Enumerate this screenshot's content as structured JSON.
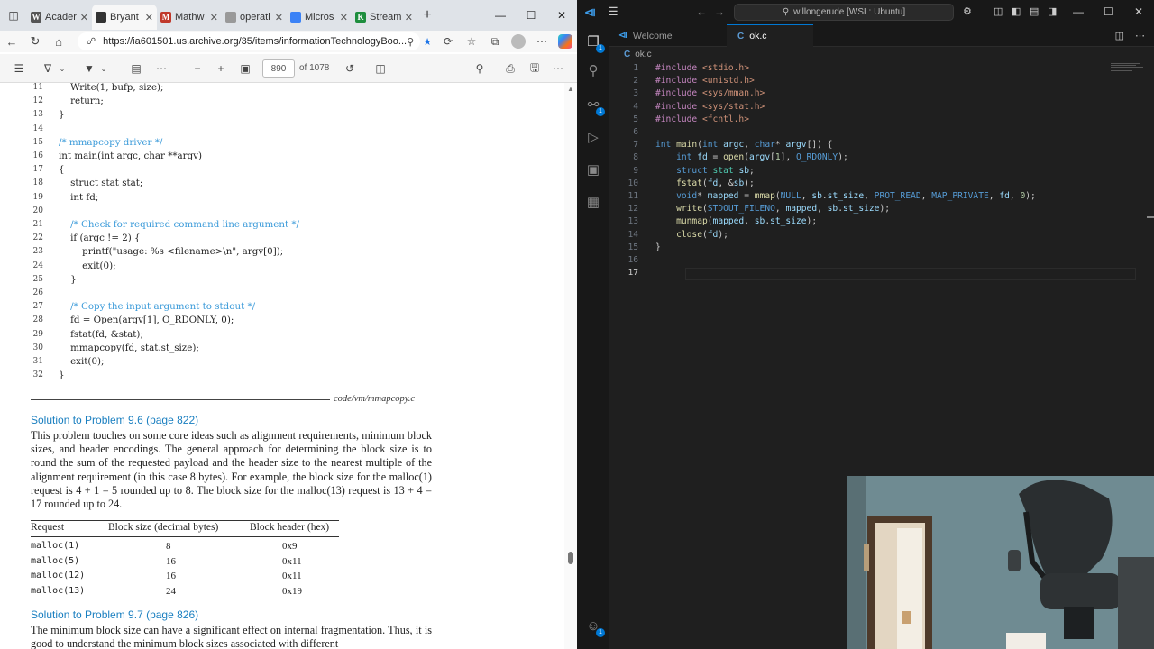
{
  "browser": {
    "tabs": [
      {
        "label": "Acader",
        "favicon": "W",
        "color": "#555555"
      },
      {
        "label": "Bryant",
        "favicon": "library-icon",
        "color": "#333333",
        "active": true
      },
      {
        "label": "Mathw",
        "favicon": "M",
        "color": "#c0392b"
      },
      {
        "label": "operati",
        "favicon": "doc-icon",
        "color": "#999999"
      },
      {
        "label": "Micros",
        "favicon": "copilot-icon",
        "color": "#3b82f6"
      },
      {
        "label": "Stream",
        "favicon": "K",
        "color": "#1e8e3e"
      }
    ],
    "url": "https://ia601501.us.archive.org/35/items/informationTechnologyBoo...",
    "pdf_toolbar": {
      "page": "890",
      "total": "of 1078"
    }
  },
  "pdf": {
    "code_lines": [
      {
        "n": "11",
        "text": "    Write(1, bufp, size);",
        "comment": false
      },
      {
        "n": "12",
        "text": "    return;",
        "comment": false
      },
      {
        "n": "13",
        "text": "}",
        "comment": false
      },
      {
        "n": "14",
        "text": "",
        "comment": false
      },
      {
        "n": "15",
        "text": "/* mmapcopy driver */",
        "comment": true
      },
      {
        "n": "16",
        "text": "int main(int argc, char **argv)",
        "comment": false
      },
      {
        "n": "17",
        "text": "{",
        "comment": false
      },
      {
        "n": "18",
        "text": "    struct stat stat;",
        "comment": false
      },
      {
        "n": "19",
        "text": "    int fd;",
        "comment": false
      },
      {
        "n": "20",
        "text": "",
        "comment": false
      },
      {
        "n": "21",
        "text": "    /* Check for required command line argument */",
        "comment": true
      },
      {
        "n": "22",
        "text": "    if (argc != 2) {",
        "comment": false
      },
      {
        "n": "23",
        "text": "        printf(\"usage: %s <filename>\\n\", argv[0]);",
        "comment": false
      },
      {
        "n": "24",
        "text": "        exit(0);",
        "comment": false
      },
      {
        "n": "25",
        "text": "    }",
        "comment": false
      },
      {
        "n": "26",
        "text": "",
        "comment": false
      },
      {
        "n": "27",
        "text": "    /* Copy the input argument to stdout */",
        "comment": true
      },
      {
        "n": "28",
        "text": "    fd = Open(argv[1], O_RDONLY, 0);",
        "comment": false
      },
      {
        "n": "29",
        "text": "    fstat(fd, &stat);",
        "comment": false
      },
      {
        "n": "30",
        "text": "    mmapcopy(fd, stat.st_size);",
        "comment": false
      },
      {
        "n": "31",
        "text": "    exit(0);",
        "comment": false
      },
      {
        "n": "32",
        "text": "}",
        "comment": false
      }
    ],
    "code_caption": "code/vm/mmapcopy.c",
    "solution_96_title": "Solution to Problem 9.6 (page 822)",
    "solution_96_text": "This problem touches on some core ideas such as alignment requirements, minimum block sizes, and header encodings. The general approach for determining the block size is to round the sum of the requested payload and the header size to the nearest multiple of the alignment requirement (in this case 8 bytes). For example, the block size for the malloc(1) request is 4 + 1 = 5 rounded up to 8. The block size for the malloc(13) request is 13 + 4 = 17 rounded up to 24.",
    "table": {
      "headers": [
        "Request",
        "Block size (decimal bytes)",
        "Block header (hex)"
      ],
      "rows": [
        [
          "malloc(1)",
          "8",
          "0x9"
        ],
        [
          "malloc(5)",
          "16",
          "0x11"
        ],
        [
          "malloc(12)",
          "16",
          "0x11"
        ],
        [
          "malloc(13)",
          "24",
          "0x19"
        ]
      ]
    },
    "solution_97_title": "Solution to Problem 9.7 (page 826)",
    "solution_97_text": "The minimum block size can have a significant effect on internal fragmentation. Thus, it is good to understand the minimum block sizes associated with different"
  },
  "vscode": {
    "search": "willongerude [WSL: Ubuntu]",
    "tabs": [
      {
        "label": "Welcome",
        "icon": "vscode-icon"
      },
      {
        "label": "ok.c",
        "icon": "c-file-icon",
        "active": true,
        "modified": true
      }
    ],
    "breadcrumb": "ok.c",
    "code_lines": [
      {
        "n": "1",
        "text": "#include <stdio.h>"
      },
      {
        "n": "2",
        "text": "#include <unistd.h>"
      },
      {
        "n": "3",
        "text": "#include <sys/mman.h>"
      },
      {
        "n": "4",
        "text": "#include <sys/stat.h>"
      },
      {
        "n": "5",
        "text": "#include <fcntl.h>"
      },
      {
        "n": "6",
        "text": ""
      },
      {
        "n": "7",
        "text": "int main(int argc, char* argv[]) {"
      },
      {
        "n": "8",
        "text": "    int fd = open(argv[1], O_RDONLY);"
      },
      {
        "n": "9",
        "text": "    struct stat sb;"
      },
      {
        "n": "10",
        "text": "    fstat(fd, &sb);"
      },
      {
        "n": "11",
        "text": "    void* mapped = mmap(NULL, sb.st_size, PROT_READ, MAP_PRIVATE, fd, 0);"
      },
      {
        "n": "12",
        "text": "    write(STDOUT_FILENO, mapped, sb.st_size);"
      },
      {
        "n": "13",
        "text": "    munmap(mapped, sb.st_size);"
      },
      {
        "n": "14",
        "text": "    close(fd);"
      },
      {
        "n": "15",
        "text": "}"
      },
      {
        "n": "16",
        "text": ""
      },
      {
        "n": "17",
        "text": ""
      }
    ],
    "activity_badges": {
      "explorer": "1",
      "source_control": "1",
      "accounts": "1"
    }
  },
  "colors": {
    "accent": "#0078d4",
    "link": "#1a7fc0",
    "comment": "#3a9ad9"
  }
}
